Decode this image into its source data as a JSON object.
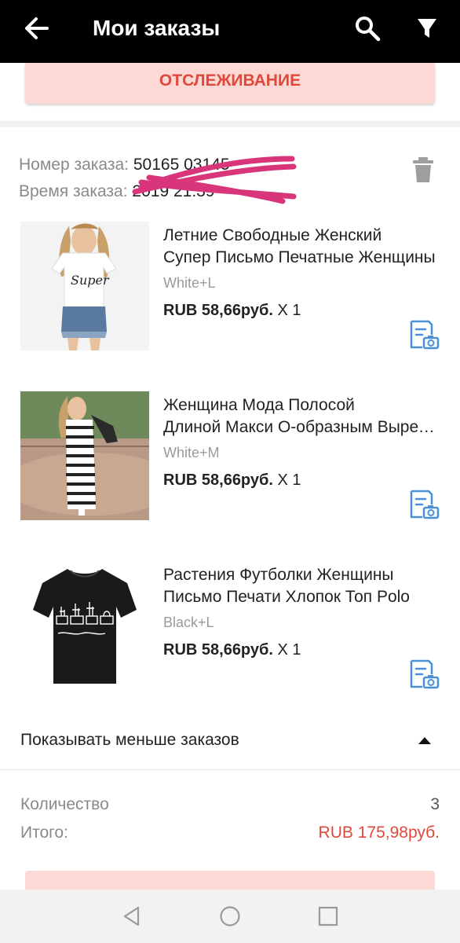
{
  "app": {
    "title": "Мои заказы",
    "icons": {
      "back": "back-arrow-icon",
      "search": "search-icon",
      "filter": "filter-icon"
    }
  },
  "tracking": {
    "label": "ОТСЛЕЖИВАНИЕ"
  },
  "order": {
    "number_label": "Номер заказа:",
    "number_value": "50165 03145",
    "time_label": "Время заказа:",
    "time_value": "2019 21:39",
    "delete_icon": "trash-icon"
  },
  "items": [
    {
      "name_line1": "Летние Свободные Женский",
      "name_line2": "Супер Письмо Печатные Женщины",
      "variant": "White+L",
      "price": "RUB 58,66руб.",
      "qty": "X 1"
    },
    {
      "name_line1": "Женщина Мода Полосой",
      "name_line2": "Длиной Макси О-образным Вырезом",
      "variant": "White+M",
      "price": "RUB 58,66руб.",
      "qty": "X 1"
    },
    {
      "name_line1": "Растения Футболки Женщины",
      "name_line2": "Письмо Печати Хлопок Топ Polo",
      "variant": "Black+L",
      "price": "RUB 58,66руб.",
      "qty": "X 1"
    }
  ],
  "show_less": {
    "label": "Показывать меньше заказов"
  },
  "summary": {
    "qty_label": "Количество",
    "qty_value": "3",
    "total_label": "Итого:",
    "total_value": "RUB 175,98руб."
  },
  "colors": {
    "accent": "#e0483c",
    "button_bg": "#fcd9d5",
    "icon_blue": "#4a90d9",
    "appbar": "#000000"
  },
  "navbar": {
    "back": "nav-back-icon",
    "home": "nav-home-icon",
    "recents": "nav-recents-icon"
  }
}
